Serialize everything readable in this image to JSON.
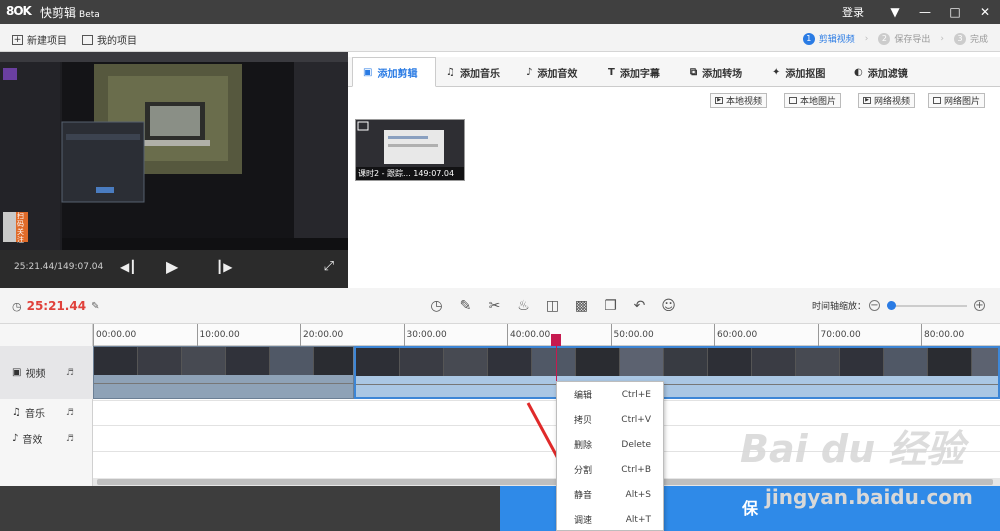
{
  "window": {
    "logo": "8OK",
    "title": "快剪辑",
    "title_suffix": "Beta",
    "login_label": "登录",
    "menu_icon": "menu-triangle-icon",
    "minimize_icon": "minimize-icon",
    "maximize_icon": "maximize-icon",
    "close_icon": "close-icon"
  },
  "toolbar": {
    "new_project": "新建项目",
    "my_projects": "我的项目"
  },
  "steps": [
    {
      "num": "1",
      "label": "剪辑视频"
    },
    {
      "num": "2",
      "label": "保存导出"
    },
    {
      "num": "3",
      "label": "完成"
    }
  ],
  "preview": {
    "time": "25:21.44/149:07.04",
    "side_text": "扫码关注"
  },
  "media_tabs": [
    "添加剪辑",
    "添加音乐",
    "添加音效",
    "添加字幕",
    "添加转场",
    "添加抠图",
    "添加滤镜"
  ],
  "source_buttons": [
    "本地视频",
    "本地图片",
    "网络视频",
    "网络图片"
  ],
  "clip_thumb": {
    "caption": "课时2 - 跟踪...  149:07.04"
  },
  "editbar": {
    "current_time": "25:21.44",
    "zoom_label": "时间轴缩放："
  },
  "tracks": {
    "video": "视频",
    "music": "音乐",
    "effect": "音效"
  },
  "ruler": [
    "00:00.00",
    "10:00.00",
    "20:00.00",
    "30:00.00",
    "40:00.00",
    "50:00.00",
    "60:00.00",
    "70:00.00",
    "80:00.00"
  ],
  "context_menu": [
    {
      "label": "编辑",
      "shortcut": "Ctrl+E"
    },
    {
      "label": "拷贝",
      "shortcut": "Ctrl+V"
    },
    {
      "label": "删除",
      "shortcut": "Delete"
    },
    {
      "label": "分割",
      "shortcut": "Ctrl+B"
    },
    {
      "label": "静音",
      "shortcut": "Alt+S"
    },
    {
      "label": "调速",
      "shortcut": "Alt+T"
    }
  ],
  "bottom": {
    "save_label": "保"
  },
  "watermark": {
    "brand": "Bai du 经验",
    "url": "jingyan.baidu.com"
  },
  "colors": {
    "accent": "#2a7be4",
    "time_red": "#e0413b",
    "playhead": "#c61a4f",
    "selected_clip": "#aac7e4"
  }
}
